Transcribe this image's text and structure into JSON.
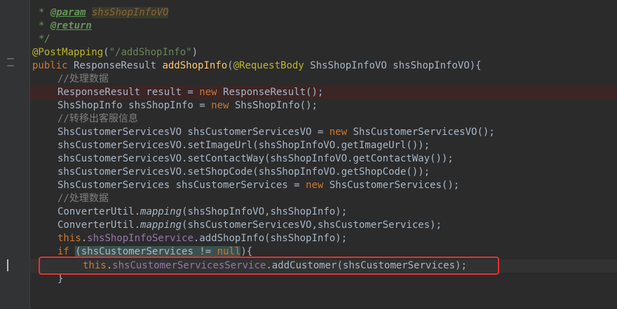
{
  "editor": {
    "lines": {
      "l1": {
        "star": "* ",
        "tag": "@param",
        "space": " ",
        "ref": "shsShopInfoVO"
      },
      "l2": {
        "star": "* ",
        "tag": "@return"
      },
      "l3": {
        "text": "*/"
      },
      "l4": {
        "ann": "@PostMapping",
        "open": "(",
        "str": "\"/addShopInfo\"",
        "close": ")"
      },
      "l5": {
        "kw": "public",
        "type": " ResponseResult ",
        "method": "addShopInfo",
        "p1": "(",
        "ann": "@RequestBody",
        "rest": " ShsShopInfoVO shsShopInfoVO){"
      },
      "l6": {
        "comment": "//处理数据"
      },
      "l7": {
        "left": "ResponseResult result = ",
        "kw": "new",
        "right": " ResponseResult();"
      },
      "l8": {
        "left": "ShsShopInfo shsShopInfo = ",
        "kw": "new",
        "right": " ShsShopInfo();"
      },
      "l9": {
        "comment": "//转移出客服信息"
      },
      "l10": {
        "left": "ShsCustomerServicesVO shsCustomerServicesVO = ",
        "kw": "new",
        "right": " ShsCustomerServicesVO();"
      },
      "l11": {
        "text": "shsCustomerServicesVO.setImageUrl(shsShopInfoVO.getImageUrl());"
      },
      "l12": {
        "text": "shsCustomerServicesVO.setContactWay(shsShopInfoVO.getContactWay());"
      },
      "l13": {
        "text": "shsCustomerServicesVO.setShopCode(shsShopInfoVO.getShopCode());"
      },
      "l14": {
        "left": "ShsCustomerServices shsCustomerServices = ",
        "kw": "new",
        "right": " ShsCustomerServices();"
      },
      "l15": {
        "comment": "//处理数据"
      },
      "l16": {
        "cls": "ConverterUtil.",
        "call": "mapping",
        "args": "(shsShopInfoVO,shsShopInfo);"
      },
      "l17": {
        "cls": "ConverterUtil.",
        "call": "mapping",
        "args": "(shsCustomerServicesVO,shsCustomerServices);"
      },
      "l18": {
        "kw": "this",
        "dot": ".",
        "field": "shsShopInfoService",
        "rest": ".addShopInfo(shsShopInfo);"
      },
      "l19": {
        "kw": "if",
        "space": " ",
        "p1": "(",
        "var": "shsCustomerServices != ",
        "null": "null",
        "p2": "){"
      },
      "l20": {
        "kw": "this",
        "dot": ".",
        "field": "shsCustomerServicesService",
        "rest": ".addCustomer(shsCustomerServices);"
      },
      "l21": {
        "text": "}"
      }
    }
  },
  "colors": {
    "background": "#2b2b2b",
    "keyword": "#cc7832",
    "annotation": "#bbb529",
    "string": "#6a8759",
    "method": "#ffc66d",
    "field": "#9876aa",
    "comment": "#808080",
    "highlight_box": "#e8312f"
  }
}
